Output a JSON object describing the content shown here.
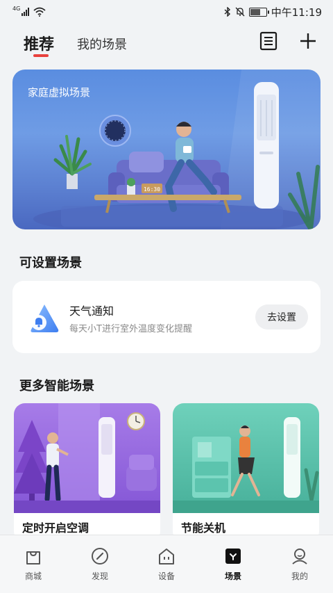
{
  "status_bar": {
    "network": "4G",
    "time": "中午11:19"
  },
  "header": {
    "tab_active": "推荐",
    "tab_inactive": "我的场景"
  },
  "hero": {
    "title": "家庭虚拟场景",
    "clock_text": "16:30"
  },
  "configurable": {
    "section_title": "可设置场景",
    "card": {
      "title": "天气通知",
      "subtitle": "每天小T进行室外温度变化提醒",
      "button": "去设置"
    }
  },
  "more": {
    "section_title": "更多智能场景",
    "cards": [
      {
        "label": "定时开启空调"
      },
      {
        "label": "节能关机"
      }
    ]
  },
  "bottom_nav": {
    "items": [
      {
        "label": "商城",
        "icon": "shopping-bag-icon"
      },
      {
        "label": "发现",
        "icon": "compass-icon"
      },
      {
        "label": "设备",
        "icon": "home-device-icon"
      },
      {
        "label": "场景",
        "icon": "scene-icon"
      },
      {
        "label": "我的",
        "icon": "profile-icon"
      }
    ],
    "active": "场景"
  },
  "colors": {
    "accent_red": "#e8413d",
    "hero_blue": "#5a8de0",
    "scene_purple": "#9b6ee0",
    "scene_teal": "#5cc4ae"
  }
}
